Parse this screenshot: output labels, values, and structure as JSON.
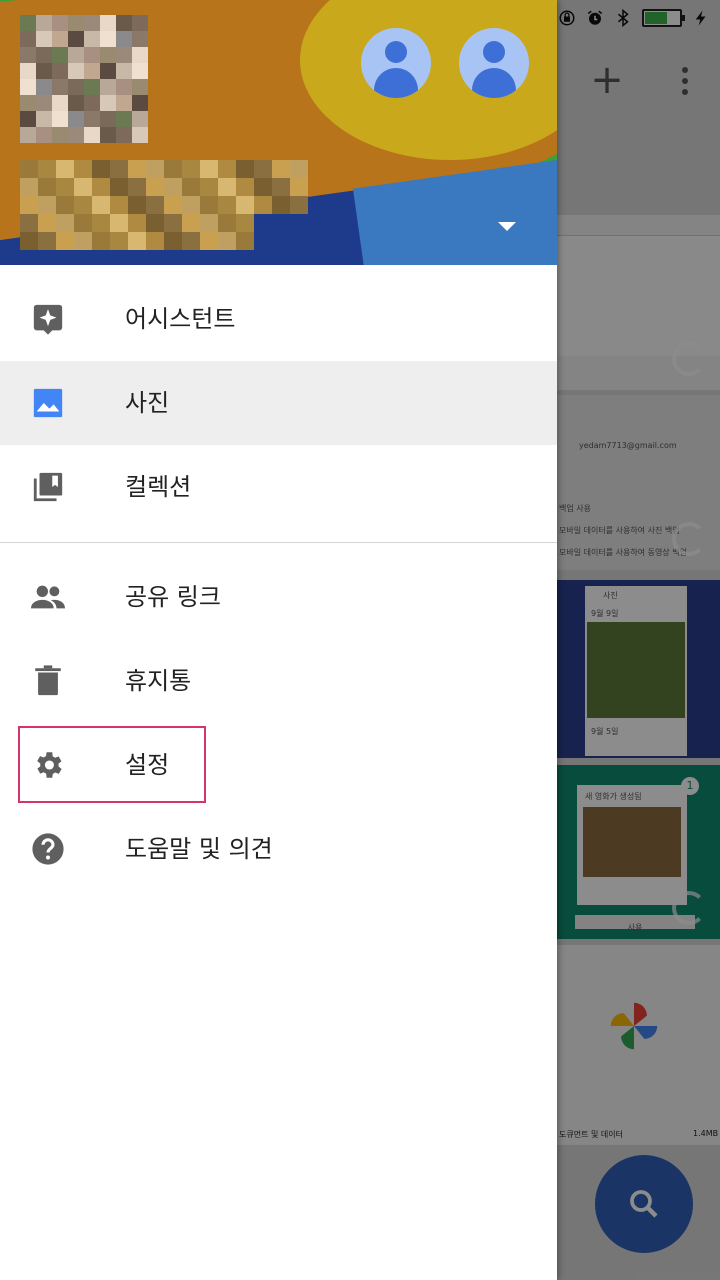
{
  "status_bar": {
    "battery_level": 0.65,
    "icons": [
      "rotation-lock-icon",
      "alarm-icon",
      "bluetooth-icon",
      "battery-icon",
      "charging-icon"
    ]
  },
  "background_app": {
    "toolbar": {
      "add_icon": "plus-icon",
      "more_icon": "more-vert-icon"
    },
    "cards": [
      {
        "name": "backup-card",
        "lines": []
      },
      {
        "name": "account-card",
        "lines": [
          "yedam7713@gmail.com",
          "백업 사용",
          "모바일 데이터를 사용하여 사진 백업",
          "모바일 데이터를 사용하여 동영상 백업"
        ]
      },
      {
        "name": "photos-card",
        "lines": [
          "사진",
          "9월 9일",
          "9월 5일"
        ]
      },
      {
        "name": "movie-card",
        "lines": [
          "새 영화가 생성됨",
          "사용"
        ],
        "badge": "1"
      },
      {
        "name": "storage-card",
        "lines": [
          "도큐먼트 및 데이터",
          "1.4MB"
        ]
      }
    ],
    "fab_icon": "search-icon"
  },
  "drawer": {
    "header": {
      "account_icons": [
        "account-avatar-icon",
        "account-avatar-icon"
      ],
      "dropdown_icon": "arrow-drop-down-icon"
    },
    "menu": [
      {
        "key": "assistant",
        "label": "어시스턴트",
        "icon": "assistant-icon",
        "selected": false
      },
      {
        "key": "photos",
        "label": "사진",
        "icon": "photo-icon",
        "selected": true
      },
      {
        "key": "collections",
        "label": "컬렉션",
        "icon": "collections-icon",
        "selected": false
      },
      {
        "key": "shared_links",
        "label": "공유 링크",
        "icon": "people-icon",
        "selected": false
      },
      {
        "key": "trash",
        "label": "휴지통",
        "icon": "trash-icon",
        "selected": false
      },
      {
        "key": "settings",
        "label": "설정",
        "icon": "gear-icon",
        "selected": false,
        "highlighted": true
      },
      {
        "key": "help",
        "label": "도움말 및 의견",
        "icon": "help-icon",
        "selected": false
      }
    ]
  },
  "colors": {
    "accent_blue": "#4285f4",
    "highlight_border": "#d6336c",
    "selected_row": "#eeeeee",
    "icon_grey": "#5f5f5f"
  }
}
